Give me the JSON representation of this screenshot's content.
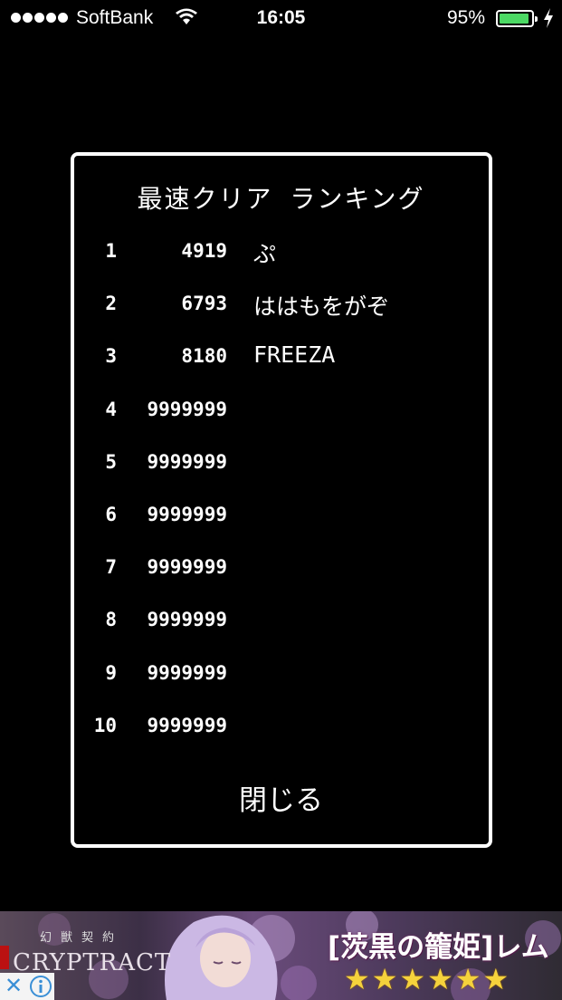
{
  "status_bar": {
    "carrier": "SoftBank",
    "time": "16:05",
    "battery_percent": "95%",
    "battery_level": 0.95,
    "signal_bars": 5,
    "icons": [
      "wifi-icon",
      "battery-icon",
      "charging-bolt-icon"
    ]
  },
  "dialog": {
    "title": "最速クリア ランキング",
    "rankings": [
      {
        "rank": "1",
        "score": "4919",
        "name": "ぷ"
      },
      {
        "rank": "2",
        "score": "6793",
        "name": "ははもをがぞ"
      },
      {
        "rank": "3",
        "score": "8180",
        "name": "FREEZA"
      },
      {
        "rank": "4",
        "score": "9999999",
        "name": ""
      },
      {
        "rank": "5",
        "score": "9999999",
        "name": ""
      },
      {
        "rank": "6",
        "score": "9999999",
        "name": ""
      },
      {
        "rank": "7",
        "score": "9999999",
        "name": ""
      },
      {
        "rank": "8",
        "score": "9999999",
        "name": ""
      },
      {
        "rank": "9",
        "score": "9999999",
        "name": ""
      },
      {
        "rank": "10",
        "score": "9999999",
        "name": ""
      }
    ],
    "close_label": "閉じる"
  },
  "ad": {
    "logo_text": "CRYPTRACT",
    "logo_subtitle": "幻獣契約",
    "headline": "[茨黒の籠姫]レム",
    "stars": "★★★★★★",
    "close_symbol": "✕",
    "icons": [
      "ad-close-icon",
      "ad-info-icon"
    ],
    "accent_color": "#f5d23c"
  }
}
